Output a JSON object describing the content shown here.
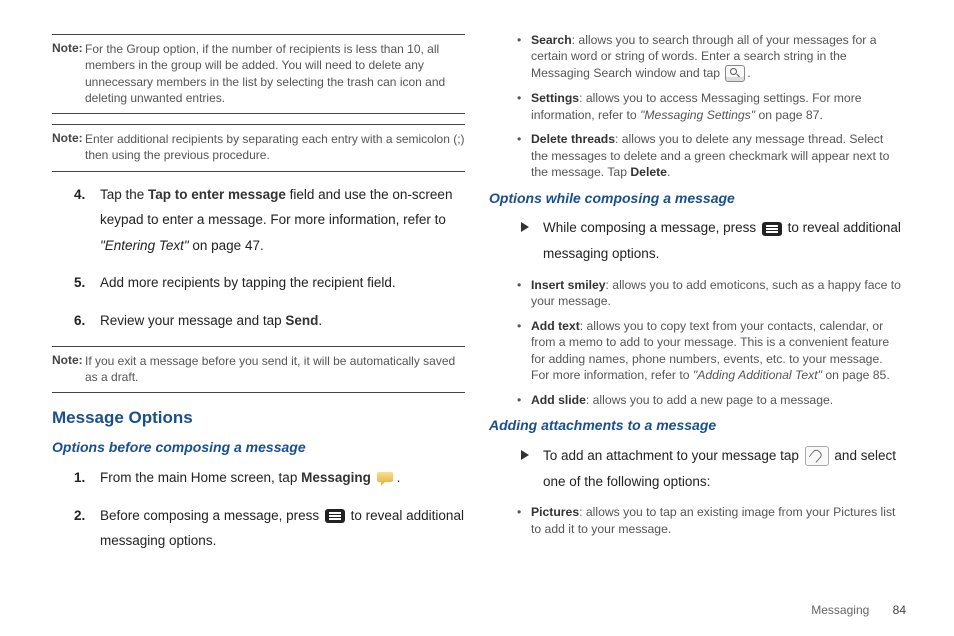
{
  "notes": {
    "n1_label": "Note:",
    "n1_body": "For the Group option, if the number of recipients is less than 10, all members in the group will be added. You will need to delete any unnecessary members in the list by selecting the trash can icon and deleting unwanted entries.",
    "n2_label": "Note:",
    "n2_body": "Enter additional recipients by separating each entry with a semicolon (;) then using the previous procedure.",
    "n3_label": "Note:",
    "n3_body": "If you exit a message before you send it, it will be automatically saved as a draft."
  },
  "steps": {
    "s4_n": "4.",
    "s4_a": "Tap the ",
    "s4_b": "Tap to enter message",
    "s4_c": " field and use the on-screen keypad to enter a message. For more information, refer to ",
    "s4_d": "\"Entering Text\"",
    "s4_e": "  on page 47.",
    "s5_n": "5.",
    "s5": "Add more recipients by tapping the recipient field.",
    "s6_n": "6.",
    "s6_a": "Review your message and tap ",
    "s6_b": "Send",
    "s6_c": "."
  },
  "headings": {
    "h1": "Message Options",
    "h2": "Options before composing a message",
    "h3": "Options while composing a message",
    "h4": "Adding attachments to a message"
  },
  "before": {
    "b1_n": "1.",
    "b1_a": "From the main Home screen, tap ",
    "b1_b": "Messaging",
    "b1_c": " ",
    "b1_d": ".",
    "b2_n": "2.",
    "b2_a": "Before composing a message, press ",
    "b2_b": " to reveal additional messaging options."
  },
  "rightbul": {
    "search_t": "Search",
    "search": ": allows you to search through all of your messages for a certain word or string of words. Enter a search string in the Messaging Search window and tap ",
    "search_end": ".",
    "settings_t": "Settings",
    "settings_a": ": allows you to access Messaging settings. For more information, refer to ",
    "settings_b": "\"Messaging Settings\"",
    "settings_c": "  on page 87.",
    "delete_t": "Delete threads",
    "delete_a": ": allows you to delete any message thread. Select the messages to delete and a green checkmark will appear next to the message. Tap ",
    "delete_b": "Delete",
    "delete_c": "."
  },
  "compose": {
    "row_a": "While composing a message, press ",
    "row_b": " to reveal additional messaging options.",
    "ins_t": "Insert smiley",
    "ins": ": allows you to add emoticons, such as a happy face to your message.",
    "add_t": "Add text",
    "add_a": ": allows you to copy text from your contacts, calendar, or from a memo to add to your message. This is a convenient feature for adding names, phone numbers, events, etc. to your message. For more information, refer to ",
    "add_b": "\"Adding Additional Text\"",
    "add_c": "  on page 85.",
    "slide_t": "Add slide",
    "slide": ": allows you to add a new page to a message."
  },
  "attach": {
    "row_a": "To add an attachment to your message tap ",
    "row_b": " and select one of the following options:",
    "pic_t": "Pictures",
    "pic": ": allows you to tap an existing image from your Pictures list to add it to your message."
  },
  "footer": {
    "section": "Messaging",
    "page": "84"
  }
}
